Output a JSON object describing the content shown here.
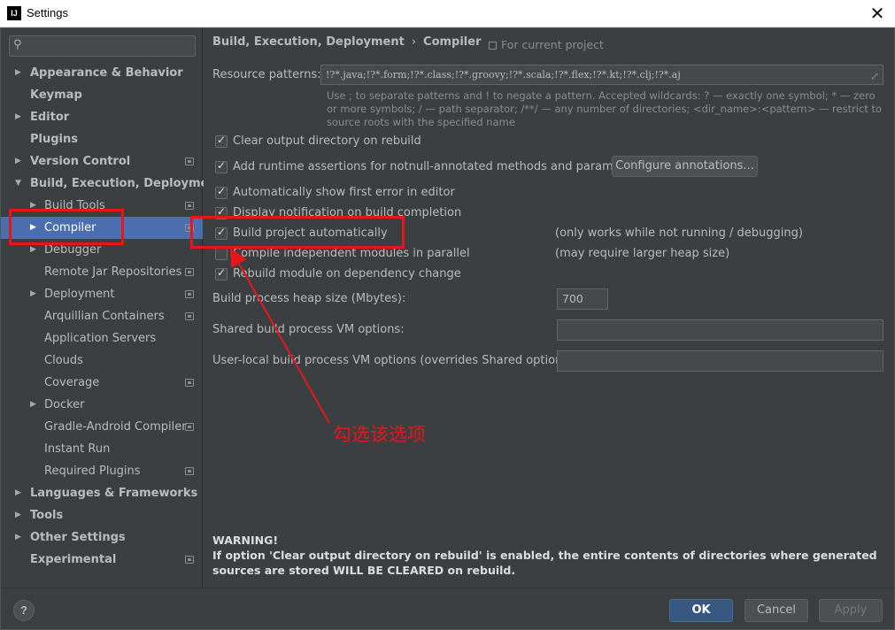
{
  "window": {
    "icon_text": "IJ",
    "title": "Settings",
    "close_glyph": "✕"
  },
  "search": {
    "placeholder": "",
    "value": ""
  },
  "sidebar": {
    "items": [
      {
        "label": "Appearance & Behavior",
        "arrow": "▶"
      },
      {
        "label": "Keymap"
      },
      {
        "label": "Editor",
        "arrow": "▶"
      },
      {
        "label": "Plugins"
      },
      {
        "label": "Version Control",
        "arrow": "▶"
      },
      {
        "label": "Build, Execution, Deployment",
        "arrow": "▼"
      },
      {
        "label": "Build Tools",
        "arrow": "▶"
      },
      {
        "label": "Compiler",
        "arrow": "▶"
      },
      {
        "label": "Debugger",
        "arrow": "▶"
      },
      {
        "label": "Remote Jar Repositories"
      },
      {
        "label": "Deployment",
        "arrow": "▶"
      },
      {
        "label": "Arquillian Containers"
      },
      {
        "label": "Application Servers"
      },
      {
        "label": "Clouds"
      },
      {
        "label": "Coverage"
      },
      {
        "label": "Docker",
        "arrow": "▶"
      },
      {
        "label": "Gradle-Android Compiler"
      },
      {
        "label": "Instant Run"
      },
      {
        "label": "Required Plugins"
      },
      {
        "label": "Languages & Frameworks",
        "arrow": "▶"
      },
      {
        "label": "Tools",
        "arrow": "▶"
      },
      {
        "label": "Other Settings",
        "arrow": "▶"
      },
      {
        "label": "Experimental"
      }
    ],
    "selected": "Compiler",
    "help_label": "?"
  },
  "breadcrumb": {
    "parent": "Build, Execution, Deployment",
    "separator": "›",
    "current": "Compiler"
  },
  "for_current_project": "For current project",
  "resource_patterns": {
    "label": "Resource patterns:",
    "value": "!?*.java;!?*.form;!?*.class;!?*.groovy;!?*.scala;!?*.flex;!?*.kt;!?*.clj;!?*.aj",
    "hint": "Use ; to separate patterns and ! to negate a pattern. Accepted wildcards: ? — exactly one symbol; * — zero or more symbols; / — path separator; /**/ — any number of directories; <dir_name>:<pattern> — restrict to source roots with the specified name"
  },
  "options": [
    {
      "label": "Clear output directory on rebuild",
      "checked": true
    },
    {
      "label": "Add runtime assertions for notnull-annotated methods and parameters",
      "checked": true
    },
    {
      "label": "Automatically show first error in editor",
      "checked": true
    },
    {
      "label": "Display notification on build completion",
      "checked": true
    },
    {
      "label": "Build project automatically",
      "checked": true,
      "note": "(only works while not running / debugging)"
    },
    {
      "label": "Compile independent modules in parallel",
      "checked": false,
      "note": "(may require larger heap size)"
    },
    {
      "label": "Rebuild module on dependency change",
      "checked": true
    }
  ],
  "configure_annotations_label": "Configure annotations...",
  "heap_size": {
    "label": "Build process heap size (Mbytes):",
    "value": "700"
  },
  "shared_vm": {
    "label": "Shared build process VM options:",
    "value": ""
  },
  "user_vm": {
    "label": "User-local build process VM options (overrides Shared options):",
    "value": ""
  },
  "warning": {
    "title": "WARNING!",
    "text": "If option 'Clear output directory on rebuild' is enabled, the entire contents of directories where generated sources are stored WILL BE CLEARED on rebuild."
  },
  "footer": {
    "ok_label": "OK",
    "cancel_label": "Cancel",
    "apply_label": "Apply"
  },
  "annotation": {
    "text": "勾选该选项",
    "color": "#e8161b"
  },
  "colors": {
    "background": "#3c3f41",
    "selection": "#4b6eaf",
    "primary_button": "#365880"
  }
}
